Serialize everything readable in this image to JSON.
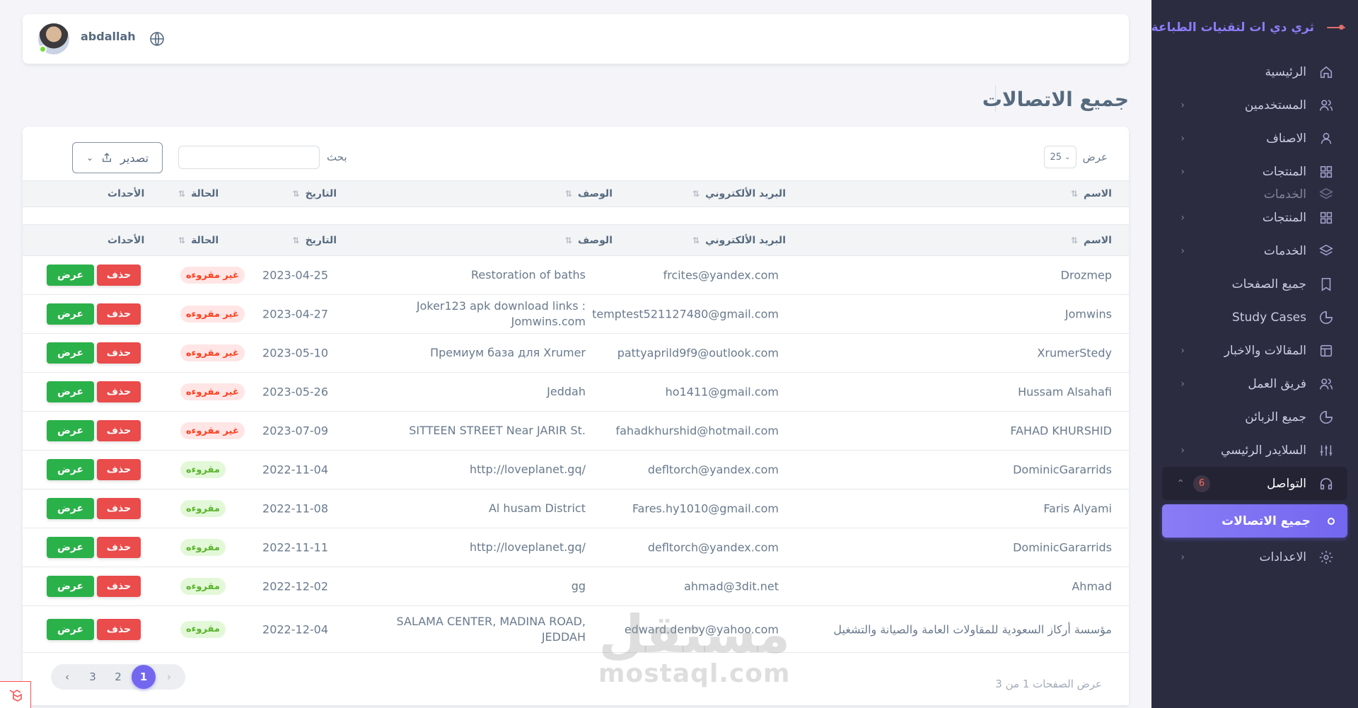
{
  "brand": {
    "name": "ثري دي ات لتقنيات الطباعة ثلاثية الأبعاد"
  },
  "user": {
    "name": "abdallah"
  },
  "sidebar": {
    "items": [
      {
        "label": "الرئيسية",
        "icon": "home-icon",
        "chevron": false
      },
      {
        "label": "المستخدمين",
        "icon": "users-icon",
        "chevron": true
      },
      {
        "label": "الاصناف",
        "icon": "user-icon",
        "chevron": true
      },
      {
        "label": "المنتجات",
        "icon": "grid-icon",
        "chevron": true
      },
      {
        "label": "الخدمات",
        "icon": "layers-icon",
        "chevron": false
      },
      {
        "label": "المنتجات",
        "icon": "grid-icon",
        "chevron": true
      },
      {
        "label": "الخدمات",
        "icon": "layers-icon",
        "chevron": true
      },
      {
        "label": "جميع الصفحات",
        "icon": "bookmark-icon",
        "chevron": false
      },
      {
        "label": "Study Cases",
        "icon": "pie-icon",
        "chevron": false
      },
      {
        "label": "المقالات والاخبار",
        "icon": "layout-icon",
        "chevron": true
      },
      {
        "label": "فريق العمل",
        "icon": "team-icon",
        "chevron": true
      },
      {
        "label": "جميع الزبائن",
        "icon": "pie-icon",
        "chevron": false
      },
      {
        "label": "السلايدر الرئيسي",
        "icon": "sliders-icon",
        "chevron": true
      },
      {
        "label": "التواصل",
        "icon": "headphones-icon",
        "badge": "6"
      },
      {
        "label": "جميع الاتصالات",
        "icon": "circle-icon"
      },
      {
        "label": "الاعدادات",
        "icon": "settings-icon",
        "chevron": true
      }
    ]
  },
  "page": {
    "title": "جميع الاتصالات"
  },
  "toolbar": {
    "show_label": "عرض",
    "page_size": "25",
    "search_label": "بحث",
    "search_placeholder": "",
    "export_label": "تصدير"
  },
  "table": {
    "columns": {
      "name": "الاسم",
      "email": "البريد الألكتروني",
      "desc": "الوصف",
      "date": "التاريخ",
      "status": "الحالة",
      "actions": "الأحداث"
    },
    "view_label": "عرض",
    "delete_label": "حذف",
    "rows": [
      {
        "name": "Drozmep",
        "email": "frcites@yandex.com",
        "desc": "Restoration of baths",
        "date": "2023-04-25",
        "status": "غير مقروءه",
        "read": false
      },
      {
        "name": "Jomwins",
        "email": "temptest521127480@gmail.com",
        "desc": "Joker123 apk download links : Jomwins.com",
        "date": "2023-04-27",
        "status": "غير مقروءه",
        "read": false
      },
      {
        "name": "XrumerStedy",
        "email": "pattyaprild9f9@outlook.com",
        "desc": "Премиум база для Xrumer",
        "date": "2023-05-10",
        "status": "غير مقروءه",
        "read": false
      },
      {
        "name": "Hussam Alsahafi",
        "email": "ho1411@gmail.com",
        "desc": "Jeddah",
        "date": "2023-05-26",
        "status": "غير مقروءه",
        "read": false
      },
      {
        "name": "FAHAD KHURSHID",
        "email": "fahadkhurshid@hotmail.com",
        "desc": "SITTEEN STREET Near JARIR St.",
        "date": "2023-07-09",
        "status": "غير مقروءه",
        "read": false
      },
      {
        "name": "DominicGararrids",
        "email": "defltorch@yandex.com",
        "desc": "http://loveplanet.gq/",
        "date": "2022-11-04",
        "status": "مقروءه",
        "read": true
      },
      {
        "name": "Faris Alyami",
        "email": "Fares.hy1010@gmail.com",
        "desc": "Al husam District",
        "date": "2022-11-08",
        "status": "مقروءه",
        "read": true
      },
      {
        "name": "DominicGararrids",
        "email": "defltorch@yandex.com",
        "desc": "http://loveplanet.gq/",
        "date": "2022-11-11",
        "status": "مقروءه",
        "read": true
      },
      {
        "name": "Ahmad",
        "email": "ahmad@3dit.net",
        "desc": "gg",
        "date": "2022-12-02",
        "status": "مقروءه",
        "read": true
      },
      {
        "name": "مؤسسة أركاز السعودية للمقاولات العامة والصيانة والتشغيل",
        "email": "edward.denby@yahoo.com",
        "desc": "SALAMA CENTER, MADINA ROAD, JEDDAH",
        "date": "2022-12-04",
        "status": "مقروءه",
        "read": true
      }
    ]
  },
  "pagination": {
    "pages": [
      "3",
      "2",
      "1"
    ],
    "active": "1",
    "info": "عرض الصفحات 1 من 3"
  },
  "watermark": {
    "ar": "مستقل",
    "en": "mostaql.com"
  },
  "colors": {
    "sidebar_bg": "#2b2c40",
    "accent": "#7367f0",
    "danger": "#ea4b4b",
    "success": "#2bb14a"
  }
}
